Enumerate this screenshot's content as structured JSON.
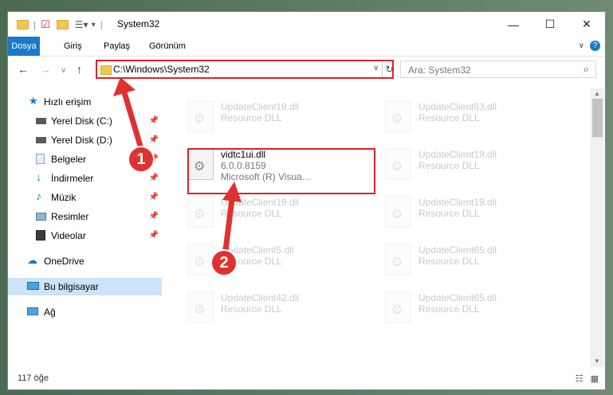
{
  "window": {
    "title": "System32"
  },
  "ribbon": {
    "tabs": [
      "Dosya",
      "Giriş",
      "Paylaş",
      "Görünüm"
    ]
  },
  "address": {
    "path": "C:\\Windows\\System32"
  },
  "search": {
    "placeholder": "Ara: System32"
  },
  "nav": {
    "items": [
      {
        "label": "Hızlı erişim"
      },
      {
        "label": "Yerel Disk (C:)"
      },
      {
        "label": "Yerel Disk (D:)"
      },
      {
        "label": "Belgeler"
      },
      {
        "label": "İndirmeler"
      },
      {
        "label": "Müzik"
      },
      {
        "label": "Resimler"
      },
      {
        "label": "Videolar"
      },
      {
        "label": "OneDrive"
      },
      {
        "label": "Bu bilgisayar"
      },
      {
        "label": "Ağ"
      }
    ]
  },
  "files": {
    "left": [
      {
        "name": "UpdateClient19.dll",
        "desc": "Resource DLL"
      },
      {
        "name": "vidtc1ui.dll",
        "desc": "6.0.0.8159",
        "extra": "Microsoft (R) Visua..."
      },
      {
        "name": "UpdateClient19.dll",
        "desc": "Resource DLL"
      },
      {
        "name": "UpdateClient5.dll",
        "desc": "Resource DLL"
      },
      {
        "name": "UpdateClient42.dll",
        "desc": "Resource DLL"
      }
    ],
    "right": [
      {
        "name": "UpdateClient63.dll",
        "desc": "Resource DLL"
      },
      {
        "name": "UpdateClient19.dll",
        "desc": "Resource DLL"
      },
      {
        "name": "UpdateClient19.dll",
        "desc": "Resource DLL"
      },
      {
        "name": "UpdateClient65.dll",
        "desc": "Resource DLL"
      },
      {
        "name": "UpdateClient65.dll",
        "desc": "Resource DLL"
      }
    ]
  },
  "status": {
    "count": "117 öğe"
  },
  "annotations": {
    "badge1": "1",
    "badge2": "2"
  },
  "colors": {
    "accent": "#1979ca",
    "highlight": "#d9232a",
    "selection": "#cce4f7"
  }
}
